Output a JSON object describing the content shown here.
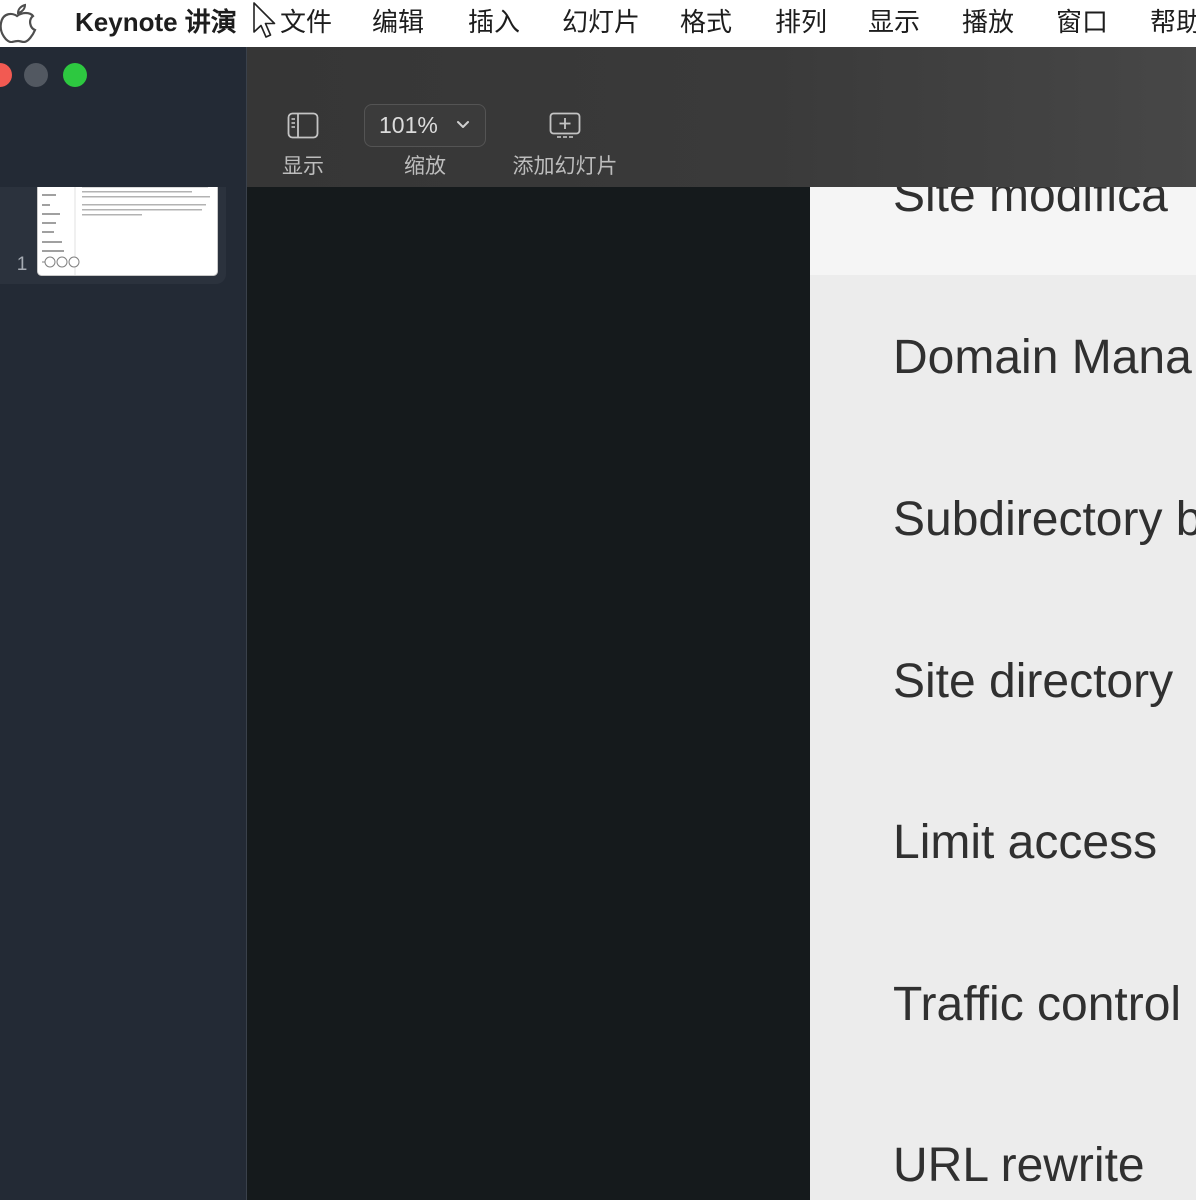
{
  "menubar": {
    "apple_icon": "apple-logo-icon",
    "app_name": "Keynote 讲演",
    "items": [
      "文件",
      "编辑",
      "插入",
      "幻灯片",
      "格式",
      "排列",
      "显示",
      "播放",
      "窗口",
      "帮助"
    ]
  },
  "window": {
    "traffic_lights": {
      "close": "#f25a52",
      "minimize": "#525861",
      "zoom": "#2dc840"
    }
  },
  "toolbar": {
    "view": {
      "icon": "sidebar-view-icon",
      "label": "显示"
    },
    "zoom": {
      "icon": "chevron-down-icon",
      "value": "101%",
      "label": "缩放"
    },
    "add_slide": {
      "icon": "add-slide-icon",
      "label": "添加幻灯片"
    }
  },
  "navigator": {
    "slides": [
      {
        "number": "1",
        "selected": true
      }
    ]
  },
  "slide": {
    "rows": [
      "Site modifica",
      "Domain Mana",
      "Subdirectory b",
      "Site directory",
      "Limit access",
      "Traffic control",
      "URL rewrite"
    ]
  },
  "colors": {
    "menubar_bg": "#ffffff",
    "sidebar_bg": "#232a35",
    "canvas_bg": "#151a1c",
    "slide_bg": "#ececec",
    "slide_text": "#303030"
  }
}
